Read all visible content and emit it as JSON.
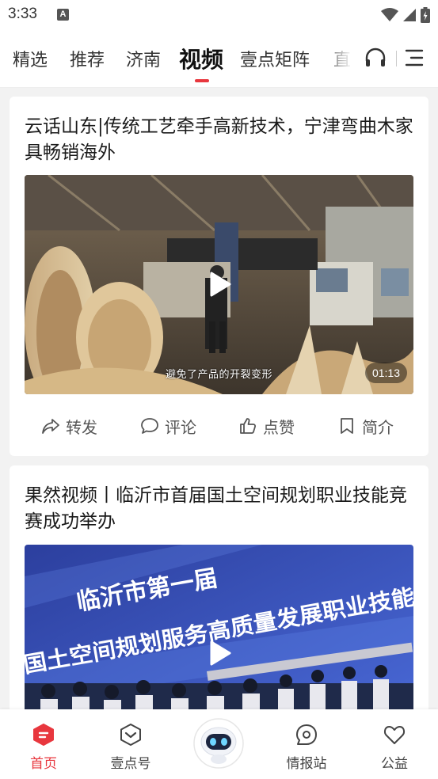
{
  "status_bar": {
    "time": "3:33",
    "notification_icon": "A"
  },
  "tabs": {
    "items": [
      {
        "label": "精选",
        "active": false
      },
      {
        "label": "推荐",
        "active": false
      },
      {
        "label": "济南",
        "active": false
      },
      {
        "label": "视频",
        "active": true
      },
      {
        "label": "壹点矩阵",
        "active": false
      },
      {
        "label": "直",
        "active": false
      }
    ]
  },
  "feed": [
    {
      "title": "云话山东|传统工艺牵手高新技术，宁津弯曲木家具畅销海外",
      "subtitle": "避免了产品的开裂变形",
      "duration": "01:13",
      "actions": {
        "share": "转发",
        "comment": "评论",
        "like": "点赞",
        "intro": "简介"
      }
    },
    {
      "title": "果然视频丨临沂市首届国土空间规划职业技能竞赛成功举办",
      "banner_line1": "临沂市第一届",
      "banner_line2": "国土空间规划服务高质量发展职业技能竞赛"
    }
  ],
  "bottom_nav": {
    "items": [
      {
        "label": "首页",
        "icon": "home-icon",
        "active": true
      },
      {
        "label": "壹点号",
        "icon": "yidianhao-icon",
        "active": false
      },
      {
        "label": "情报站",
        "icon": "intel-station-icon",
        "active": false
      },
      {
        "label": "公益",
        "icon": "heart-icon",
        "active": false
      }
    ]
  },
  "colors": {
    "accent": "#e8373e",
    "text": "#1a1a1a",
    "muted": "#555555",
    "background": "#f2f2f2"
  }
}
